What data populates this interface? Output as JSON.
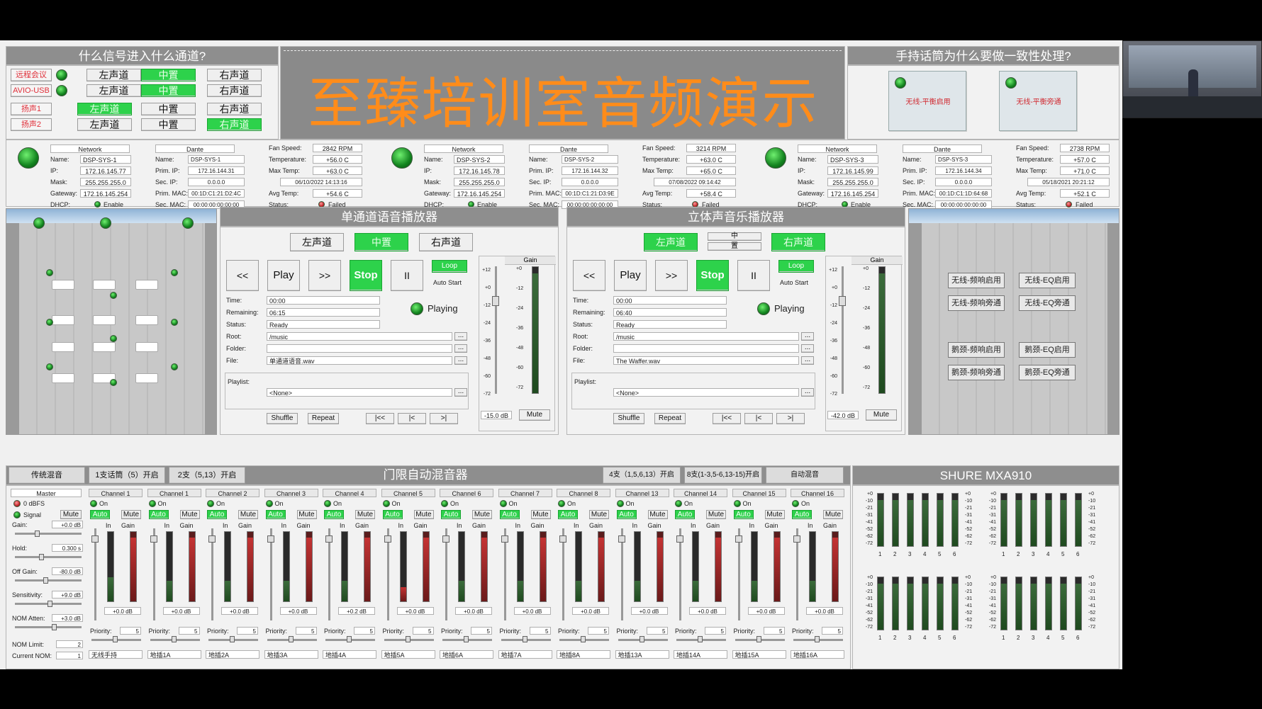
{
  "sections": {
    "signal_routing_title": "什么信号进入什么通道?",
    "handheld_title": "手持话筒为什么要做一致性处理?",
    "main_title": "至臻培训室音频演示",
    "mono_player_title": "单通道语音播放器",
    "stereo_player_title": "立体声音乐播放器",
    "automixer_title": "门限自动混音器",
    "mxa_title": "SHURE MXA910"
  },
  "routing": {
    "rows": [
      {
        "source": "远程会议",
        "left": "左声道",
        "center": "中置",
        "right": "右声道",
        "active": "center"
      },
      {
        "source": "AVIO-USB",
        "left": "左声道",
        "center": "中置",
        "right": "右声道",
        "active": "center"
      },
      {
        "source": "扬声1",
        "left": "左声道",
        "center": "中置",
        "right": "右声道",
        "active": "left"
      },
      {
        "source": "扬声2",
        "left": "左声道",
        "center": "中置",
        "right": "右声道",
        "active": "right"
      }
    ]
  },
  "handheld": {
    "buttons": [
      "无线-平衡启用",
      "无线-平衡旁通"
    ]
  },
  "dsp_labels": {
    "network": "Network",
    "dante": "Dante",
    "name": "Name:",
    "ip": "IP:",
    "mask": "Mask:",
    "gateway": "Gateway:",
    "dhcp": "DHCP:",
    "prim_ip": "Prim. IP:",
    "sec_ip": "Sec. IP:",
    "prim_mac": "Prim. MAC:",
    "sec_mac": "Sec. MAC:",
    "fan": "Fan Speed:",
    "temp": "Temperature:",
    "maxtemp": "Max Temp:",
    "avgtemp": "Avg Temp:",
    "status": "Status:"
  },
  "dsp_units": [
    {
      "name": "DSP-SYS-1",
      "ip": "172.16.145.77",
      "mask": "255.255.255.0",
      "gateway": "172.16.145.254",
      "dhcp": "Enable",
      "dante_name": "DSP-SYS-1",
      "prim_ip": "172.16.144.31",
      "sec_ip": "0.0.0.0",
      "prim_mac": "00:1D:C1:21:D2:4C",
      "sec_mac": "00:00:00:00:00:00",
      "fan": "2842 RPM",
      "temp": "+56.0 C",
      "maxtemp": "+63.0 C",
      "date": "06/10/2022 14:13:16",
      "avgtemp": "+54.6 C",
      "status": "Failed"
    },
    {
      "name": "DSP-SYS-2",
      "ip": "172.16.145.78",
      "mask": "255.255.255.0",
      "gateway": "172.16.145.254",
      "dhcp": "Enable",
      "dante_name": "DSP-SYS-2",
      "prim_ip": "172.16.144.32",
      "sec_ip": "0.0.0.0",
      "prim_mac": "00:1D:C1:21:D3:9E",
      "sec_mac": "00:00:00:00:00:00",
      "fan": "3214 RPM",
      "temp": "+63.0 C",
      "maxtemp": "+65.0 C",
      "date": "07/08/2022 09:14:42",
      "avgtemp": "+58.4 C",
      "status": "Failed"
    },
    {
      "name": "DSP-SYS-3",
      "ip": "172.16.145.99",
      "mask": "255.255.255.0",
      "gateway": "172.16.145.254",
      "dhcp": "Enable",
      "dante_name": "DSP-SYS-3",
      "prim_ip": "172.16.144.34",
      "sec_ip": "0.0.0.0",
      "prim_mac": "00:1D:C1:1D:64:68",
      "sec_mac": "00:00:00:00:00:00",
      "fan": "2738 RPM",
      "temp": "+57.0 C",
      "maxtemp": "+71.0 C",
      "date": "05/18/2021 20:21:12",
      "avgtemp": "+52.1 C",
      "status": "Failed"
    }
  ],
  "player_labels": {
    "rew": "<<",
    "play": "Play",
    "ffw": ">>",
    "stop": "Stop",
    "pause": "II",
    "loop": "Loop",
    "autostart": "Auto Start",
    "playing": "Playing",
    "time": "Time:",
    "remaining": "Remaining:",
    "status": "Status:",
    "root": "Root:",
    "folder": "Folder:",
    "file": "File:",
    "playlist": "Playlist:",
    "shuffle": "Shuffle",
    "repeat": "Repeat",
    "first": "|<<",
    "prev": "|<",
    "next": ">|",
    "browse": "...",
    "gain": "Gain",
    "mute": "Mute"
  },
  "mono_player": {
    "channels": [
      "左声道",
      "中置",
      "右声道"
    ],
    "time": "00:00",
    "remaining": "06:15",
    "status": "Ready",
    "root": "/music",
    "folder": "",
    "file": "单通道语音.wav",
    "playlist": "<None>",
    "gain": "-15.0 dB"
  },
  "stereo_player": {
    "channels": [
      "左声道",
      "中",
      "置",
      "右声道"
    ],
    "time": "00:00",
    "remaining": "06:40",
    "status": "Ready",
    "root": "/music",
    "folder": "",
    "file": "The Waffer.wav",
    "playlist": "<None>",
    "gain": "-42.0 dB"
  },
  "meter_scale": [
    "+12",
    "+0",
    "-12",
    "-24",
    "-36",
    "-48",
    "-60",
    "-72"
  ],
  "gain_scale": [
    "+0",
    "-12",
    "-24",
    "-36",
    "-48",
    "-60",
    "-72"
  ],
  "ceiling_controls": {
    "buttons": [
      "无线-频响启用",
      "无线-EQ启用",
      "无线-频响旁通",
      "无线-EQ旁通",
      "鹅颈-频响启用",
      "鹅颈-EQ启用",
      "鹅颈-频响旁通",
      "鹅颈-EQ旁通"
    ]
  },
  "automixer": {
    "tabs_left": [
      "传统混音",
      "1支话筒（5）开启",
      "2支（5,13）开启"
    ],
    "tabs_right": [
      "4支（1,5,6,13）开启",
      "8支(1-3,5-6,13-15)开启",
      "自动混音"
    ],
    "master": {
      "title": "Master",
      "zero_dbfs": "0 dBFS",
      "signal": "Signal",
      "mute": "Mute",
      "gain_label": "Gain:",
      "gain": "+0.0 dB",
      "hold_label": "Hold:",
      "hold": "0.300 s",
      "offgain_label": "Off Gain:",
      "offgain": "-80.0 dB",
      "sens_label": "Sensitivity:",
      "sens": "+9.0 dB",
      "nom_label": "NOM Atten:",
      "nom": "+3.0 dB",
      "nomlimit_label": "NOM Limit:",
      "nomlimit": "2",
      "currentnom_label": "Current NOM:",
      "currentnom": "1"
    },
    "strip_labels": {
      "on": "On",
      "auto": "Auto",
      "mute": "Mute",
      "in": "In",
      "gain": "Gain",
      "priority": "Priority:"
    },
    "channels": [
      {
        "title": "Channel 1",
        "gain": "+0.0 dB",
        "priority": "5",
        "label": "无线手持",
        "level": 0.35,
        "hot": false
      },
      {
        "title": "Channel 1",
        "gain": "+0.0 dB",
        "priority": "5",
        "label": "地插1A",
        "level": 0.3,
        "hot": false
      },
      {
        "title": "Channel 2",
        "gain": "+0.0 dB",
        "priority": "5",
        "label": "地插2A",
        "level": 0.3,
        "hot": false
      },
      {
        "title": "Channel 3",
        "gain": "+0.0 dB",
        "priority": "5",
        "label": "地插3A",
        "level": 0.3,
        "hot": false
      },
      {
        "title": "Channel 4",
        "gain": "+0.2 dB",
        "priority": "5",
        "label": "地插4A",
        "level": 0.3,
        "hot": false
      },
      {
        "title": "Channel 5",
        "gain": "+0.0 dB",
        "priority": "5",
        "label": "地插5A",
        "level": 0.2,
        "hot": true
      },
      {
        "title": "Channel 6",
        "gain": "+0.0 dB",
        "priority": "5",
        "label": "地插6A",
        "level": 0.3,
        "hot": false
      },
      {
        "title": "Channel 7",
        "gain": "+0.0 dB",
        "priority": "5",
        "label": "地插7A",
        "level": 0.3,
        "hot": false
      },
      {
        "title": "Channel 8",
        "gain": "+0.0 dB",
        "priority": "5",
        "label": "地插8A",
        "level": 0.3,
        "hot": false
      },
      {
        "title": "Channel 13",
        "gain": "+0.0 dB",
        "priority": "5",
        "label": "地插13A",
        "level": 0.3,
        "hot": false
      },
      {
        "title": "Channel 14",
        "gain": "+0.0 dB",
        "priority": "5",
        "label": "地插14A",
        "level": 0.3,
        "hot": false
      },
      {
        "title": "Channel 15",
        "gain": "+0.0 dB",
        "priority": "5",
        "label": "地插15A",
        "level": 0.3,
        "hot": false
      },
      {
        "title": "Channel 16",
        "gain": "+0.0 dB",
        "priority": "5",
        "label": "地插16A",
        "level": 0.3,
        "hot": false
      }
    ]
  },
  "mxa": {
    "scale": [
      "+0",
      "-10",
      "-21",
      "-31",
      "-41",
      "-52",
      "-62",
      "-72"
    ],
    "channel_numbers": [
      "1",
      "2",
      "3",
      "4",
      "5",
      "6"
    ]
  }
}
